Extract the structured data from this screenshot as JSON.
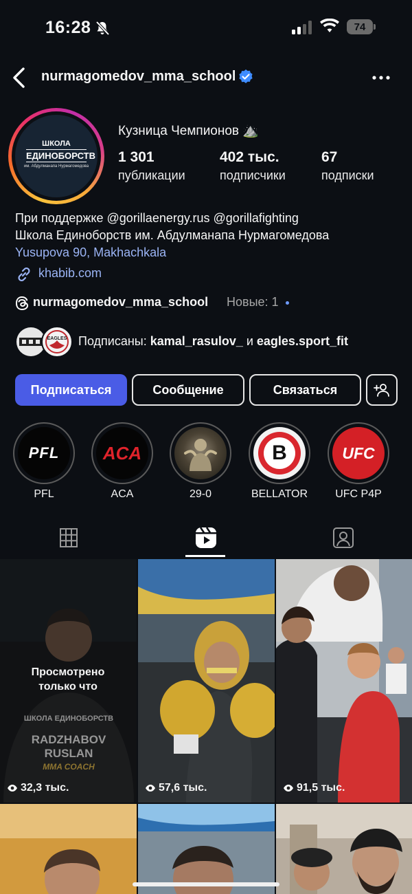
{
  "status_bar": {
    "time": "16:28",
    "battery": "74"
  },
  "header": {
    "username": "nurmagomedov_mma_school"
  },
  "profile": {
    "avatar_text": {
      "line1": "ШКОЛА",
      "line2": "ЕДИНОБОРСТВ",
      "line3": "им. Абдулманапа Нурмагомедова"
    },
    "name": "Кузница Чемпионов ⛰️",
    "stats": [
      {
        "value": "1 301",
        "label": "публикации"
      },
      {
        "value": "402 тыс.",
        "label": "подписчики"
      },
      {
        "value": "67",
        "label": "подписки"
      }
    ],
    "bio_line1": "При поддержке @gorillaenergy.rus @gorillafighting",
    "bio_line2": "Школа Единоборств им. Абдулманапа Нурмагомедова",
    "location": "Yusupova 90, Makhachkala",
    "link": "khabib.com",
    "threads_username": "nurmagomedov_mma_school",
    "threads_new": "Новые: 1",
    "followed_by_prefix": "Подписаны: ",
    "followed_by_user1": "kamal_rasulov_",
    "followed_by_and": " и ",
    "followed_by_user2": "eagles.sport_fit",
    "follower_avatar2_text": "EAGLES"
  },
  "buttons": {
    "follow": "Подписаться",
    "message": "Сообщение",
    "contact": "Связаться"
  },
  "highlights": [
    {
      "label": "PFL",
      "logo_text": "PFL"
    },
    {
      "label": "ACA",
      "logo_text": "ACA"
    },
    {
      "label": "29-0",
      "logo_text": ""
    },
    {
      "label": "BELLATOR",
      "logo_text": "B"
    },
    {
      "label": "UFC P4P",
      "logo_text": "UFC"
    }
  ],
  "reels": [
    {
      "views": "32,3 тыс.",
      "overlay": "Просмотрено только что",
      "shirt_line1": "RADZHABOV",
      "shirt_line2": "RUSLAN",
      "shirt_line3": "MMA COACH",
      "shirt_top": "ШКОЛА ЕДИНОБОРСТВ"
    },
    {
      "views": "57,6 тыс."
    },
    {
      "views": "91,5 тыс."
    }
  ],
  "colors": {
    "accent": "#4a5ce6",
    "link": "#9bb4f5",
    "background": "#0c0f14",
    "verified": "#3f8cff"
  }
}
